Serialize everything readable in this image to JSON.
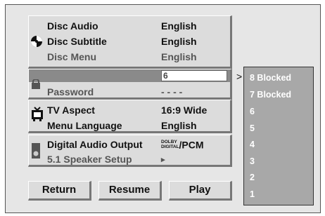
{
  "menu": {
    "disc_audio": {
      "label": "Disc Audio",
      "value": "English"
    },
    "disc_subtitle": {
      "label": "Disc Subtitle",
      "value": "English"
    },
    "disc_menu": {
      "label": "Disc Menu",
      "value": "English"
    },
    "rating": {
      "value": "6"
    },
    "password": {
      "label": "Password",
      "value": "- - - -"
    },
    "tv_aspect": {
      "label": "TV Aspect",
      "value": "16:9 Wide"
    },
    "menu_language": {
      "label": "Menu Language",
      "value": "English"
    },
    "digital_audio_output": {
      "label": "Digital Audio Output",
      "value_logo_top": "DOLBY",
      "value_logo_bottom": "DIGITAL",
      "value_suffix": "/PCM"
    },
    "speaker_setup": {
      "label": "5.1 Speaker Setup",
      "value": "▸"
    }
  },
  "rating_list": {
    "arrow": ">",
    "items": [
      "8 Blocked",
      "7 Blocked",
      "6",
      "5",
      "4",
      "3",
      "2",
      "1"
    ]
  },
  "buttons": {
    "return": "Return",
    "resume": "Resume",
    "play": "Play"
  },
  "icons": [
    "disc-icon",
    "lock-icon",
    "tv-icon",
    "speaker-icon"
  ]
}
